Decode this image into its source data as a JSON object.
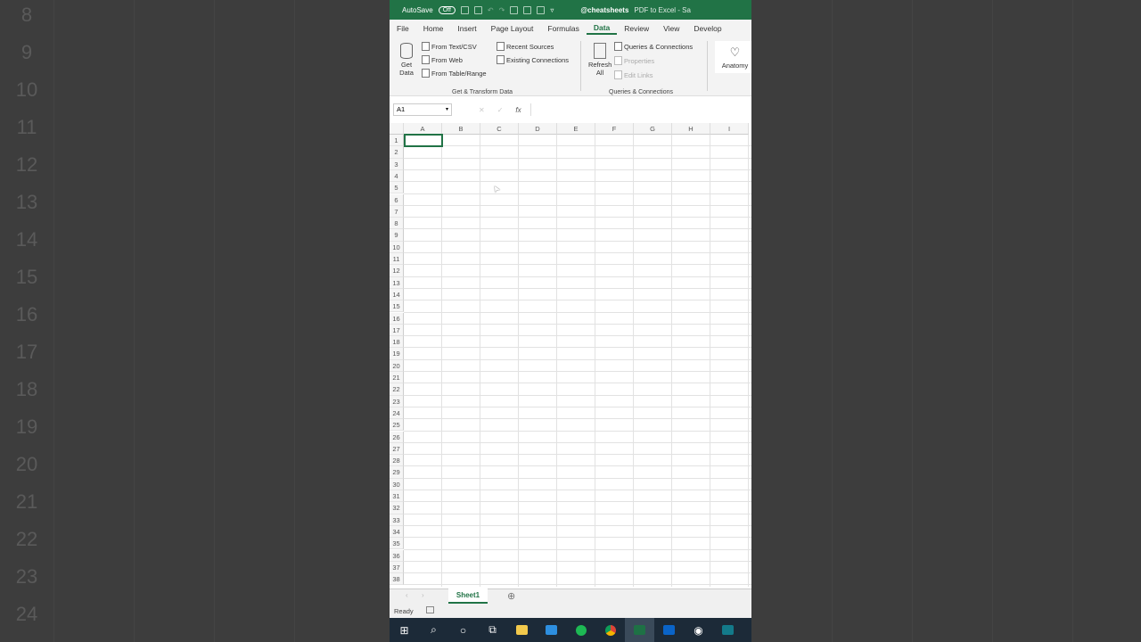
{
  "background": {
    "row_numbers": [
      "8",
      "9",
      "10",
      "11",
      "12",
      "13",
      "14",
      "15",
      "16",
      "17",
      "18",
      "19",
      "20",
      "21",
      "22",
      "23",
      "24"
    ]
  },
  "titlebar": {
    "autosave": "AutoSave",
    "toggle": "Off",
    "account": "@cheatsheets",
    "doc": "PDF to Excel - Sa"
  },
  "menu": [
    "File",
    "Home",
    "Insert",
    "Page Layout",
    "Formulas",
    "Data",
    "Review",
    "View",
    "Develop"
  ],
  "active_menu": "Data",
  "ribbon": {
    "get_data": "Get Data",
    "from_text": "From Text/CSV",
    "from_web": "From Web",
    "from_table": "From Table/Range",
    "recent": "Recent Sources",
    "existing": "Existing Connections",
    "group1": "Get & Transform Data",
    "refresh": "Refresh All",
    "queries": "Queries & Connections",
    "properties": "Properties",
    "edit_links": "Edit Links",
    "group2": "Queries & Connections",
    "anatomy": "Anatomy"
  },
  "formula": {
    "namebox": "A1",
    "fx": "fx",
    "value": ""
  },
  "columns": [
    "A",
    "B",
    "C",
    "D",
    "E",
    "F",
    "G",
    "H",
    "I"
  ],
  "rows": [
    "1",
    "2",
    "3",
    "4",
    "5",
    "6",
    "7",
    "8",
    "9",
    "10",
    "11",
    "12",
    "13",
    "14",
    "15",
    "16",
    "17",
    "18",
    "19",
    "20",
    "21",
    "22",
    "23",
    "24",
    "25",
    "26",
    "27",
    "28",
    "29",
    "30",
    "31",
    "32",
    "33",
    "34",
    "35",
    "36",
    "37",
    "38"
  ],
  "sheet_tab": "Sheet1",
  "status": "Ready",
  "colors": {
    "accent": "#217346",
    "taskbar": "#1c2a38"
  }
}
